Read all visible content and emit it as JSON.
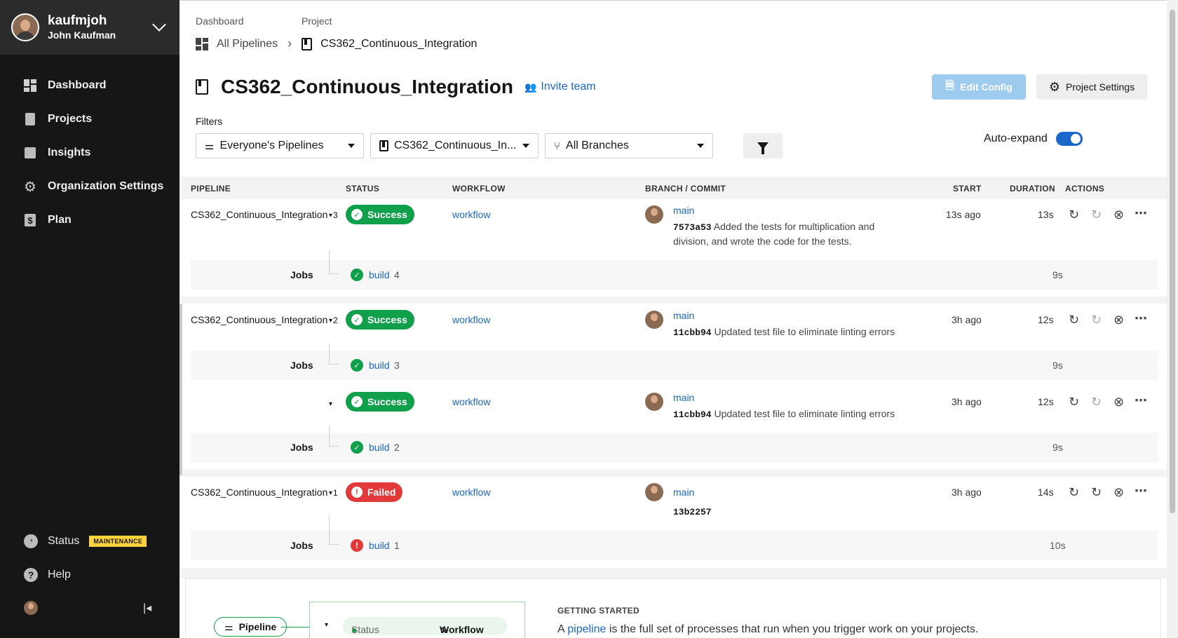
{
  "user": {
    "login": "kaufmjoh",
    "full_name": "John Kaufman"
  },
  "sidebar": {
    "items": [
      {
        "label": "Dashboard",
        "icon": "dashboard-icon"
      },
      {
        "label": "Projects",
        "icon": "projects-icon"
      },
      {
        "label": "Insights",
        "icon": "insights-icon"
      },
      {
        "label": "Organization Settings",
        "icon": "gear-icon"
      },
      {
        "label": "Plan",
        "icon": "dollar-icon"
      }
    ],
    "status_label": "Status",
    "status_badge": "MAINTENANCE",
    "help_label": "Help"
  },
  "breadcrumb": {
    "dashboard_label": "Dashboard",
    "project_label": "Project",
    "all_pipelines": "All Pipelines",
    "project_name": "CS362_Continuous_Integration"
  },
  "header": {
    "title": "CS362_Continuous_Integration",
    "invite": "Invite team",
    "edit_config": "Edit Config",
    "project_settings": "Project Settings"
  },
  "filters": {
    "label": "Filters",
    "pipelines": "Everyone's Pipelines",
    "project": "CS362_Continuous_In...",
    "branches": "All Branches",
    "auto_expand": "Auto-expand"
  },
  "table": {
    "headers": [
      "PIPELINE",
      "STATUS",
      "WORKFLOW",
      "BRANCH / COMMIT",
      "START",
      "DURATION",
      "ACTIONS"
    ],
    "jobs_label": "Jobs",
    "pipelines": [
      {
        "name": "CS362_Continuous_Integration",
        "number": "3",
        "status": "Success",
        "workflow": "workflow",
        "branch": "main",
        "commit": "7573a53",
        "message_1": "Added the tests for multiplication and",
        "message_2": "division, and wrote the code for the tests.",
        "start": "13s ago",
        "duration": "13s",
        "job": "build",
        "job_num": "4",
        "job_duration": "9s"
      },
      {
        "name": "CS362_Continuous_Integration",
        "number": "2",
        "status": "Success",
        "workflow": "workflow",
        "branch": "main",
        "commit": "11cbb94",
        "message_1": "Updated test file to eliminate linting errors",
        "start": "3h ago",
        "duration": "12s",
        "job": "build",
        "job_num": "3",
        "job_duration": "9s"
      },
      {
        "status": "Success",
        "workflow": "workflow",
        "branch": "main",
        "commit": "11cbb94",
        "message_1": "Updated test file to eliminate linting errors",
        "start": "3h ago",
        "duration": "12s",
        "job": "build",
        "job_num": "2",
        "job_duration": "9s"
      },
      {
        "name": "CS362_Continuous_Integration",
        "number": "1",
        "status": "Failed",
        "workflow": "workflow",
        "branch": "main",
        "commit": "13b2257",
        "start": "3h ago",
        "duration": "14s",
        "job": "build",
        "job_num": "1",
        "job_duration": "10s"
      }
    ]
  },
  "getting_started": {
    "pill": "Pipeline",
    "status": "Status",
    "workflow": "Workflow",
    "heading": "GETTING STARTED",
    "text_before": "A ",
    "text_link": "pipeline",
    "text_after": " is the full set of processes that run when you trigger work on your projects."
  },
  "colors": {
    "success": "#109f4a",
    "failed": "#e23a3a",
    "link": "#1a66c9",
    "sidebar": "#161616"
  }
}
